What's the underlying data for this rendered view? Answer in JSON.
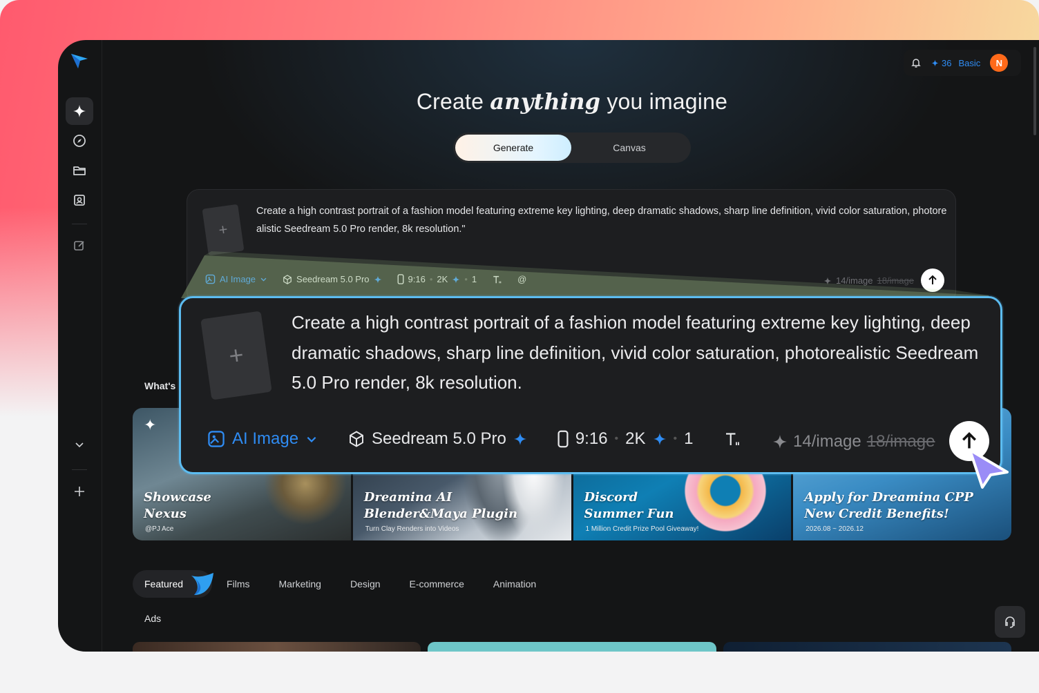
{
  "header": {
    "headline_pre": "Create ",
    "headline_em": "anything",
    "headline_post": " you imagine",
    "credits": "36",
    "plan": "Basic",
    "avatar_initial": "N"
  },
  "modes": {
    "generate": "Generate",
    "canvas": "Canvas",
    "active": "Generate"
  },
  "prompt": {
    "text": "Create a high contrast portrait of a fashion model featuring extreme key lighting, deep dramatic shadows, sharp line definition, vivid color saturation, photorealistic Seedream 5.0 Pro render, 8k resolution.\"",
    "type": "AI Image",
    "model": "Seedream 5.0 Pro",
    "ratio": "9:16",
    "resolution": "2K",
    "count": "1",
    "mention": "@",
    "cost": "14/image",
    "cost_old": "18/image"
  },
  "zoom": {
    "text": "Create a high contrast portrait of a fashion model featuring extreme key lighting, deep dramatic shadows, sharp line definition, vivid color saturation, photorealistic Seedream 5.0 Pro render, 8k resolution.",
    "type": "AI Image",
    "model": "Seedream 5.0 Pro",
    "ratio": "9:16",
    "resolution": "2K",
    "count": "1",
    "cost": "14/image",
    "cost_old": "18/image"
  },
  "whats_new": "What's",
  "banners": [
    {
      "title_1": "Showcase",
      "title_2": "Nexus",
      "sub": "@PJ Ace"
    },
    {
      "title_1": "Dreamina AI",
      "title_2": "Blender&Maya Plugin",
      "sub": "Turn Clay Renders into Videos"
    },
    {
      "title_1": "Discord",
      "title_2": "Summer Fun",
      "sub": "1 Million Credit Prize Pool Giveaway!"
    },
    {
      "title_1": "Apply for Dreamina CPP",
      "title_2": "New Credit Benefits!",
      "sub": "2026.08 ~ 2026.12"
    }
  ],
  "tabs": [
    "Featured",
    "Films",
    "Marketing",
    "Design",
    "E-commerce",
    "Animation"
  ],
  "section_label": "Ads",
  "colors": {
    "accent_blue": "#2f8cf3",
    "zoom_border": "#5cbcf0",
    "avatar": "#ff6a1a",
    "app_bg": "#141516"
  },
  "icons": [
    "logo-icon",
    "sparkle-icon",
    "compass-icon",
    "folder-icon",
    "profile-icon",
    "edit-icon",
    "chevron-down-icon",
    "plus-icon",
    "bell-icon",
    "image-icon",
    "cube-icon",
    "phone-ratio-icon",
    "text-icon",
    "arrow-up-icon",
    "cursor-icon",
    "headset-icon"
  ]
}
